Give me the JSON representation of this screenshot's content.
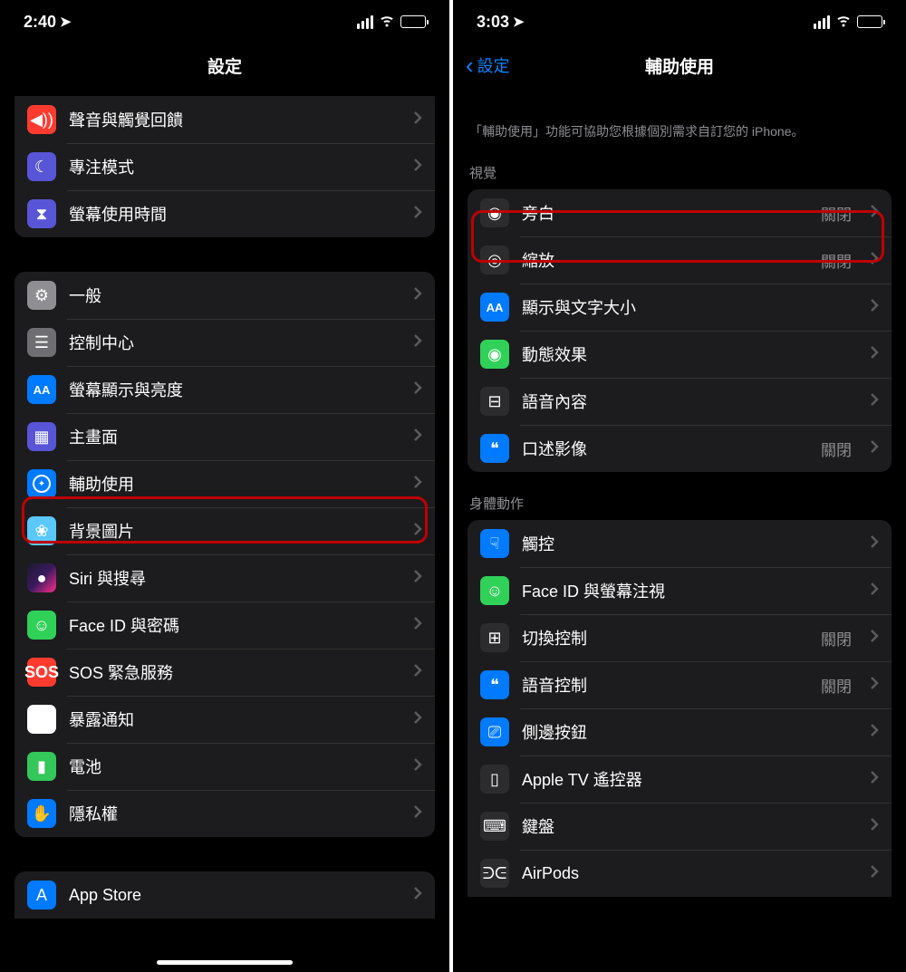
{
  "left": {
    "time": "2:40",
    "title": "設定",
    "group1": [
      {
        "label": "聲音與觸覺回饋",
        "icon": "sound-icon",
        "bg": "bg-red",
        "glyph": "◀︎))"
      },
      {
        "label": "專注模式",
        "icon": "focus-icon",
        "bg": "bg-indigo",
        "glyph": "☾"
      },
      {
        "label": "螢幕使用時間",
        "icon": "screentime-icon",
        "bg": "bg-indigo",
        "glyph": "⧗"
      }
    ],
    "group2": [
      {
        "label": "一般",
        "icon": "general-icon",
        "bg": "bg-gray",
        "glyph": "⚙"
      },
      {
        "label": "控制中心",
        "icon": "control-center-icon",
        "bg": "bg-gray2",
        "glyph": "☰"
      },
      {
        "label": "螢幕顯示與亮度",
        "icon": "display-icon",
        "bg": "bg-blue",
        "glyph": "AA"
      },
      {
        "label": "主畫面",
        "icon": "home-screen-icon",
        "bg": "bg-indigo",
        "glyph": "▦"
      },
      {
        "label": "輔助使用",
        "icon": "accessibility-icon",
        "bg": "bg-blue",
        "glyph": "acc"
      },
      {
        "label": "背景圖片",
        "icon": "wallpaper-icon",
        "bg": "bg-teal",
        "glyph": "❀"
      },
      {
        "label": "Siri 與搜尋",
        "icon": "siri-icon",
        "bg": "bg-gradient-siri",
        "glyph": "●"
      },
      {
        "label": "Face ID 與密碼",
        "icon": "faceid-icon",
        "bg": "bg-green",
        "glyph": "☺"
      },
      {
        "label": "SOS 緊急服務",
        "icon": "sos-icon",
        "bg": "bg-sos",
        "glyph": "SOS"
      },
      {
        "label": "暴露通知",
        "icon": "exposure-icon",
        "bg": "bg-exposure",
        "glyph": "✱"
      },
      {
        "label": "電池",
        "icon": "battery-icon",
        "bg": "bg-green2",
        "glyph": "▮"
      },
      {
        "label": "隱私權",
        "icon": "privacy-icon",
        "bg": "bg-blue",
        "glyph": "✋"
      }
    ],
    "group3": [
      {
        "label": "App Store",
        "icon": "appstore-icon",
        "bg": "bg-blue",
        "glyph": "A"
      }
    ]
  },
  "right": {
    "time": "3:03",
    "back": "設定",
    "title": "輔助使用",
    "description": "「輔助使用」功能可協助您根據個別需求自訂您的 iPhone。",
    "section_vision": "視覺",
    "vision_items": [
      {
        "label": "旁白",
        "status": "關閉",
        "icon": "voiceover-icon",
        "bg": "bg-dark",
        "glyph": "◉"
      },
      {
        "label": "縮放",
        "status": "關閉",
        "icon": "zoom-icon",
        "bg": "bg-dark",
        "glyph": "◎"
      },
      {
        "label": "顯示與文字大小",
        "status": "",
        "icon": "textsize-icon",
        "bg": "bg-blue",
        "glyph": "AA"
      },
      {
        "label": "動態效果",
        "status": "",
        "icon": "motion-icon",
        "bg": "bg-green",
        "glyph": "◉"
      },
      {
        "label": "語音內容",
        "status": "",
        "icon": "spoken-icon",
        "bg": "bg-dark",
        "glyph": "⊟"
      },
      {
        "label": "口述影像",
        "status": "關閉",
        "icon": "audio-desc-icon",
        "bg": "bg-blue",
        "glyph": "❝"
      }
    ],
    "section_motor": "身體動作",
    "motor_items": [
      {
        "label": "觸控",
        "status": "",
        "icon": "touch-icon",
        "bg": "bg-blue",
        "glyph": "☟"
      },
      {
        "label": "Face ID 與螢幕注視",
        "status": "",
        "icon": "faceid-attn-icon",
        "bg": "bg-green",
        "glyph": "☺"
      },
      {
        "label": "切換控制",
        "status": "關閉",
        "icon": "switch-icon",
        "bg": "bg-dark",
        "glyph": "⊞"
      },
      {
        "label": "語音控制",
        "status": "關閉",
        "icon": "voice-control-icon",
        "bg": "bg-blue",
        "glyph": "❝"
      },
      {
        "label": "側邊按鈕",
        "status": "",
        "icon": "side-button-icon",
        "bg": "bg-blue",
        "glyph": "⎚"
      },
      {
        "label": "Apple TV 遙控器",
        "status": "",
        "icon": "appletv-icon",
        "bg": "bg-dark",
        "glyph": "▯"
      },
      {
        "label": "鍵盤",
        "status": "",
        "icon": "keyboard-icon",
        "bg": "bg-dark",
        "glyph": "⌨"
      },
      {
        "label": "AirPods",
        "status": "",
        "icon": "airpods-icon",
        "bg": "bg-dark",
        "glyph": "ᕭᕮ"
      }
    ]
  }
}
